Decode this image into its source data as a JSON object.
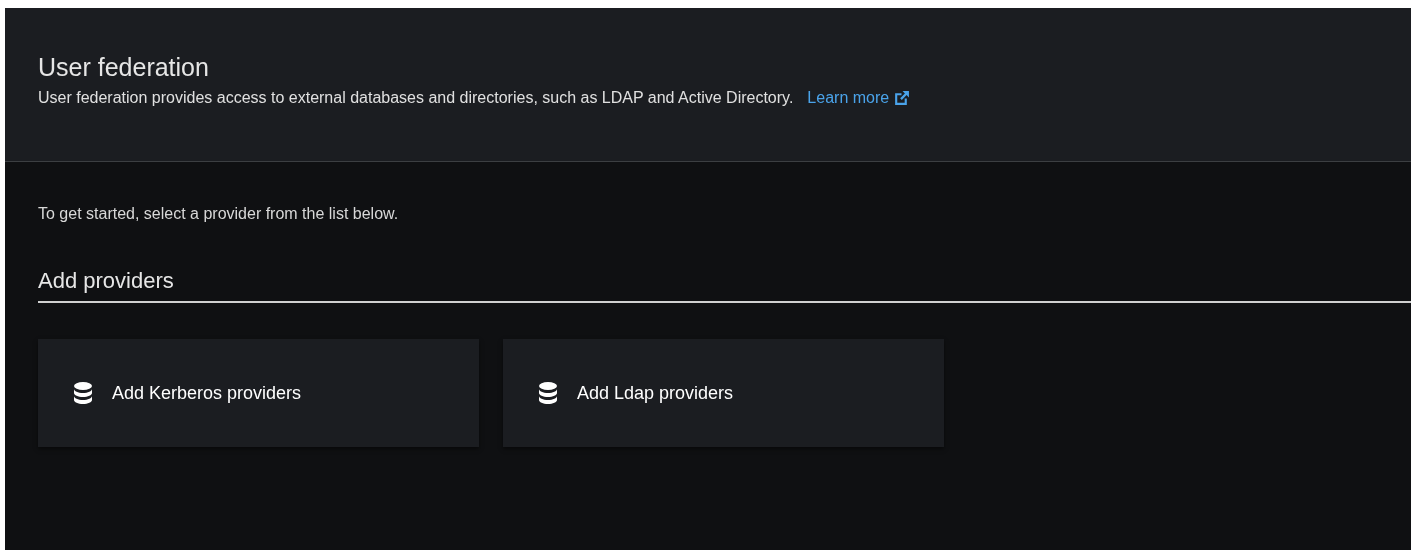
{
  "header": {
    "title": "User federation",
    "description": "User federation provides access to external databases and directories, such as LDAP and Active Directory.",
    "link": "Learn more"
  },
  "intro": "To get started, select a provider from the list below.",
  "section": {
    "title": "Add providers"
  },
  "providers": [
    {
      "label": "Add Kerberos providers"
    },
    {
      "label": "Add Ldap providers"
    }
  ]
}
